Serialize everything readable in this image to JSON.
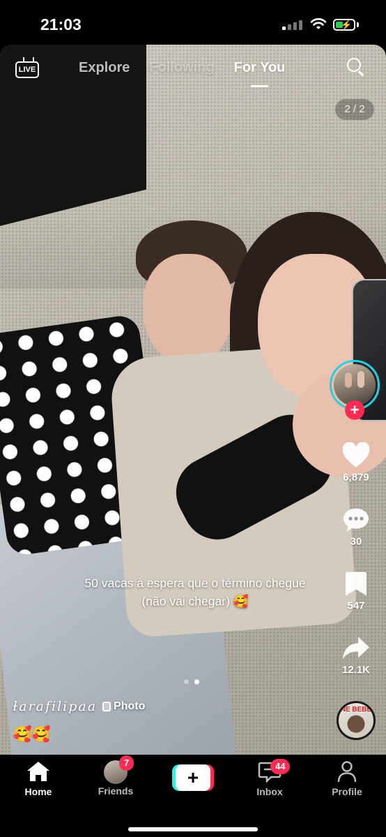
{
  "status_bar": {
    "time": "21:03"
  },
  "top_nav": {
    "live_label": "LIVE",
    "tabs": [
      {
        "label": "Explore"
      },
      {
        "label": "Following"
      },
      {
        "label": "For You"
      }
    ],
    "active_tab": "For You"
  },
  "page_counter": "2 / 2",
  "right_rail": {
    "likes": "6,879",
    "comments": "30",
    "saves": "547",
    "shares": "12.1K",
    "music_disc_text": "NE BEBE"
  },
  "post": {
    "caption_line1": "50 vacas à espera que o término chegue",
    "caption_line2": "(não vai chegar) 🥰",
    "username": "ɫarafilipaa",
    "photo_badge": "Photo",
    "emoji_line": "🥰🥰",
    "carousel_total": 2,
    "carousel_active": 2
  },
  "bottom_nav": {
    "home": "Home",
    "friends": "Friends",
    "friends_badge": "7",
    "create": "+",
    "inbox": "Inbox",
    "inbox_badge": "44",
    "profile": "Profile"
  },
  "colors": {
    "accent_red": "#fe2c55",
    "accent_cyan": "#25f4ee",
    "battery_green": "#34c759"
  }
}
